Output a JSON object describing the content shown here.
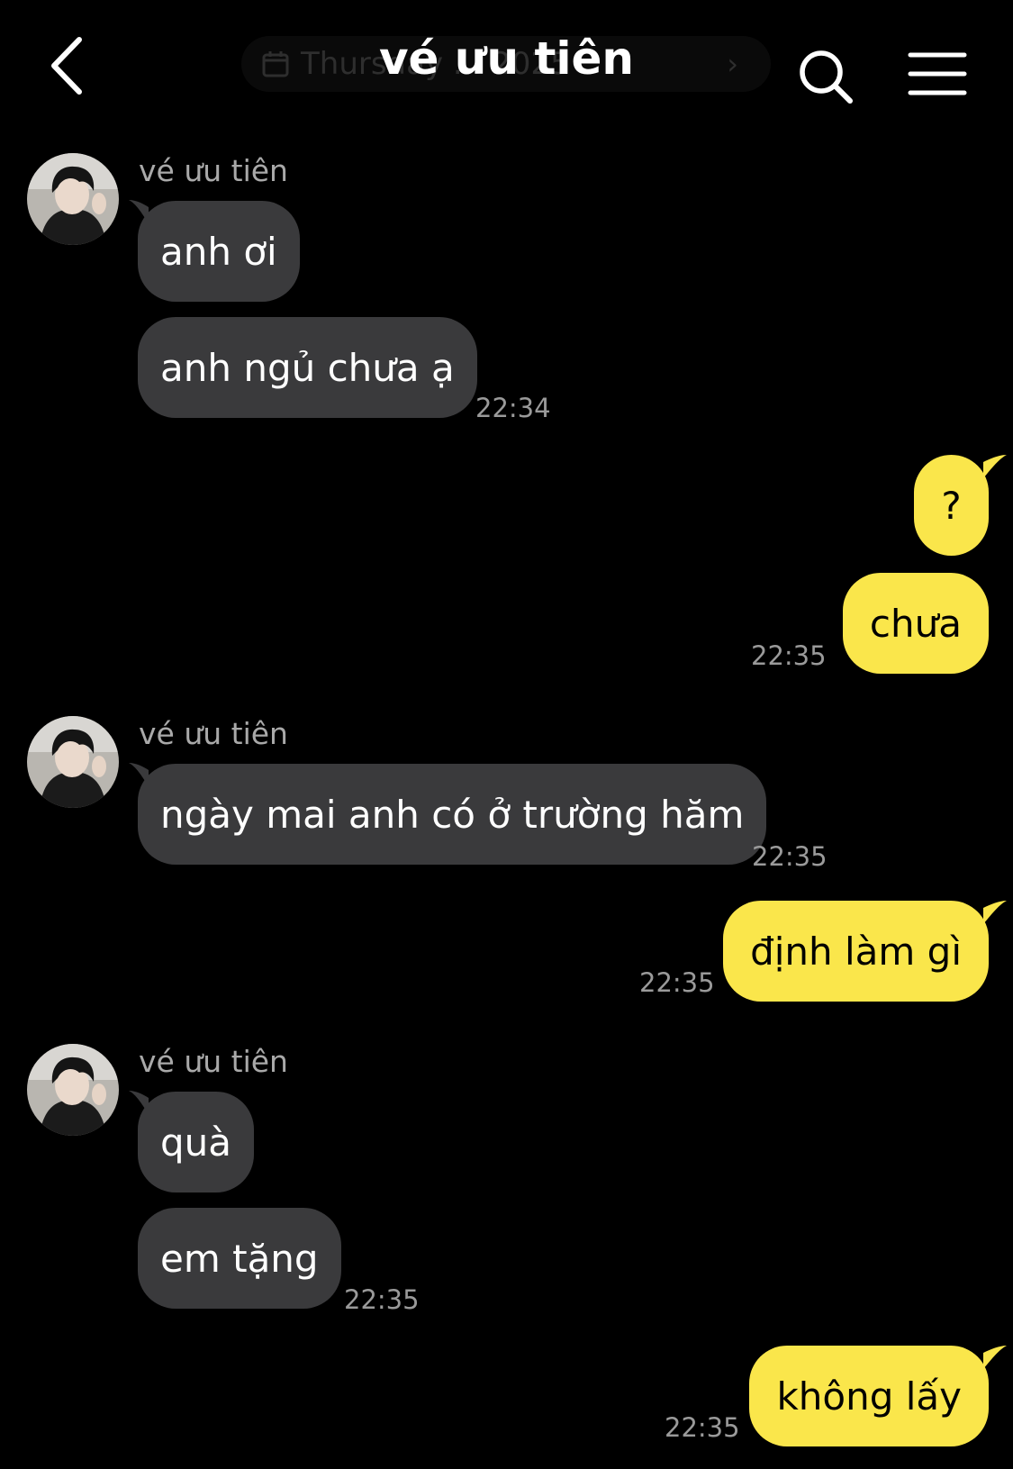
{
  "header": {
    "title": "vé ưu tiên",
    "date_pill_text": "Thursday ... 2025",
    "date_chevron": "›",
    "icons": {
      "back": "chevron-left-icon",
      "calendar": "calendar-icon",
      "search": "search-icon",
      "menu": "hamburger-menu-icon"
    }
  },
  "colors": {
    "background": "#000000",
    "incoming_bubble": "#3a3a3c",
    "outgoing_bubble": "#fae64b",
    "timestamp": "#9a9a9a",
    "sender_name": "#a9a9a9"
  },
  "chat": {
    "groups": [
      {
        "sender": "vé ưu tiên",
        "messages": [
          "anh ơi",
          "anh ngủ chưa ạ"
        ],
        "time": "22:34"
      },
      {
        "sender": "me",
        "messages": [
          "?",
          "chưa"
        ],
        "time": "22:35"
      },
      {
        "sender": "vé ưu tiên",
        "messages": [
          "ngày mai anh có ở trường hăm"
        ],
        "time": "22:35"
      },
      {
        "sender": "me",
        "messages": [
          "định làm gì"
        ],
        "time": "22:35"
      },
      {
        "sender": "vé ưu tiên",
        "messages": [
          "quà",
          "em tặng"
        ],
        "time": "22:35"
      },
      {
        "sender": "me",
        "messages": [
          "không lấy"
        ],
        "time": "22:35"
      }
    ]
  }
}
